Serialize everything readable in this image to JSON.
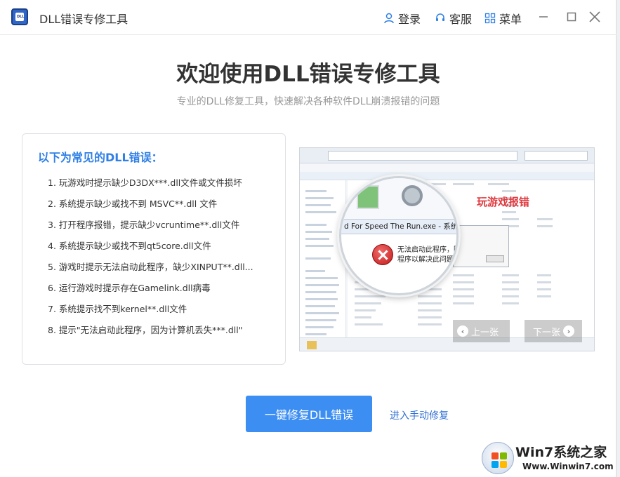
{
  "titlebar": {
    "app_title": "DLL错误专修工具",
    "login": "登录",
    "service": "客服",
    "menu": "菜单"
  },
  "header": {
    "title": "欢迎使用DLL错误专修工具",
    "subtitle": "专业的DLL修复工具，快速解决各种软件DLL崩溃报错的问题"
  },
  "errors": {
    "heading": "以下为常见的DLL错误：",
    "items": [
      "1. 玩游戏时提示缺少D3DX***.dll文件或文件损坏",
      "2. 系统提示缺少或找不到 MSVC**.dll 文件",
      "3. 打开程序报错，提示缺少vcruntime**.dll文件",
      "4. 系统提示缺少或找不到qt5core.dll文件",
      "5. 游戏时提示无法启动此程序，缺少XINPUT**.dll...",
      "6. 运行游戏时提示存在Gamelink.dll病毒",
      "7. 系统提示找不到kernel**.dll文件",
      "8. 提示\"无法启动此程序，因为计算机丢失***.dll\""
    ]
  },
  "preview": {
    "label": "玩游戏报错",
    "dialog_caption": "d For Speed The Run.exe - 系统错误",
    "dialog_line1": "无法启动此程序，因为计算机中丢",
    "dialog_line2": "程序以解决此问题。",
    "prev": "上一张",
    "next": "下一张"
  },
  "actions": {
    "fix_button": "一键修复DLL错误",
    "manual_link": "进入手动修复"
  },
  "watermark": {
    "brand": "Win7系统之家",
    "url": "Www.Winwin7.com"
  },
  "colors": {
    "accent": "#3c8ef2",
    "heading_blue": "#2f7fe6",
    "error_red": "#e0393e"
  }
}
